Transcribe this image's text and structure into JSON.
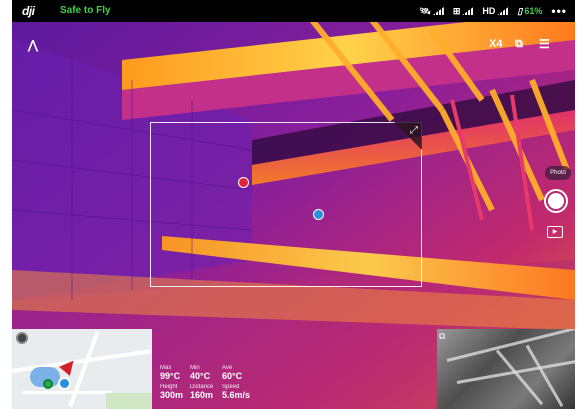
{
  "topbar": {
    "logo": "dji",
    "flight_status": "Safe to Fly",
    "gps_label": "",
    "rc_label": "",
    "hd_label": "HD",
    "battery": "61%",
    "more": "•••"
  },
  "camera": {
    "zoom": "X4",
    "photo_label": "Photo"
  },
  "telemetry": {
    "max_label": "Max",
    "max_value": "99°C",
    "min_label": "Min",
    "min_value": "40°C",
    "ave_label": "Ave",
    "ave_value": "60°C",
    "height_label": "Height",
    "height_value": "300m",
    "distance_label": "Distance",
    "distance_value": "160m",
    "speed_label": "Speed",
    "speed_value": "5.6m/s"
  },
  "colors": {
    "status_green": "#3fd04a",
    "hot_marker": "#e0223a",
    "cold_marker": "#2b8fe0"
  },
  "icons": [
    "aircraft-icon",
    "satellite-signal-icon",
    "rc-signal-icon",
    "battery-icon",
    "more-icon",
    "swap-view-icon",
    "camera-settings-icon",
    "sliders-icon",
    "expand-icon",
    "shutter-icon",
    "playback-icon",
    "compass-icon"
  ]
}
